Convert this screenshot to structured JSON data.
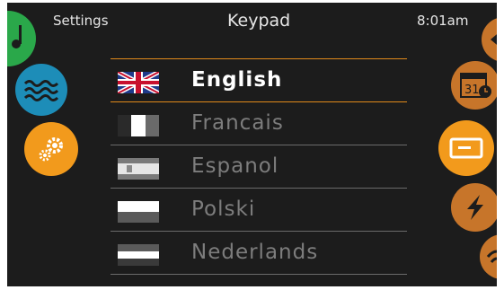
{
  "header": {
    "left": "Settings",
    "title": "Keypad",
    "time": "8:01am"
  },
  "left_nav": [
    {
      "icon": "music-note-icon",
      "color": "#2aa84a"
    },
    {
      "icon": "water-waves-icon",
      "color": "#1d8db8"
    },
    {
      "icon": "settings-gears-icon",
      "color": "#f29a1c"
    }
  ],
  "right_nav": [
    {
      "icon": "arrow-icon",
      "color": "#c7752a"
    },
    {
      "icon": "calendar-clock-icon",
      "color": "#c7752a",
      "text": "31"
    },
    {
      "icon": "keypad-icon",
      "color": "#f29a1c"
    },
    {
      "icon": "lightning-bolt-icon",
      "color": "#c7752a"
    },
    {
      "icon": "wifi-icon",
      "color": "#c7752a"
    }
  ],
  "languages": [
    {
      "label": "English",
      "flag": "uk-flag-icon",
      "selected": true
    },
    {
      "label": "Francais",
      "flag": "france-flag-icon",
      "selected": false
    },
    {
      "label": "Espanol",
      "flag": "spain-flag-icon",
      "selected": false
    },
    {
      "label": "Polski",
      "flag": "poland-flag-icon",
      "selected": false
    },
    {
      "label": "Nederlands",
      "flag": "netherlands-flag-icon",
      "selected": false
    }
  ],
  "colors": {
    "accent": "#f29a1c",
    "background": "#1c1c1c"
  }
}
